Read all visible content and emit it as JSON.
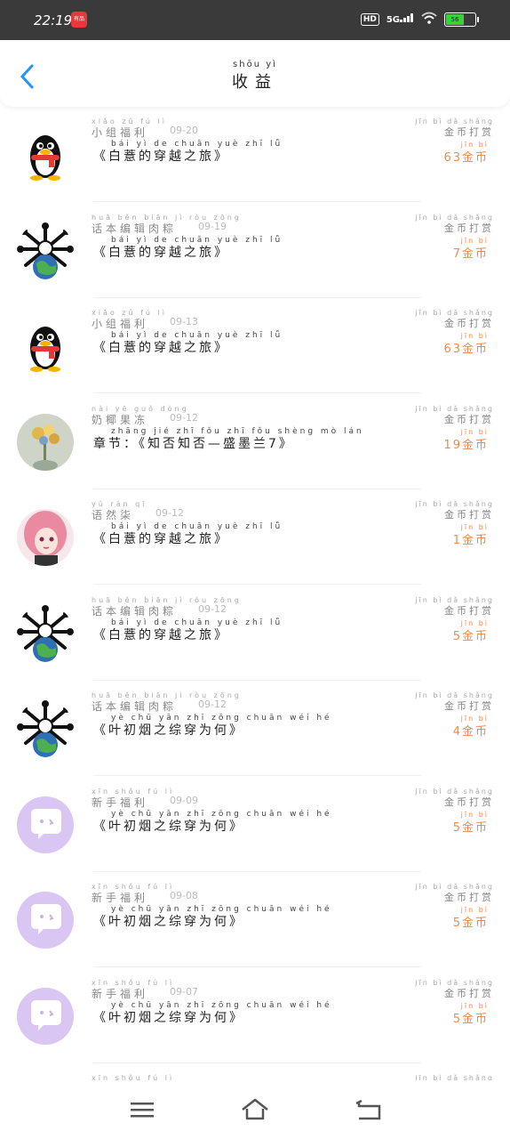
{
  "status": {
    "time": "22:19",
    "notif_text": "有品",
    "hd": "HD",
    "network": "5G",
    "battery": "56"
  },
  "header": {
    "title_pinyin": "shōu yì",
    "title": "收益"
  },
  "rows": [
    {
      "avatar": "penguin",
      "name_py": "xiǎo zǔ fú lì",
      "name": "小组福利",
      "date": "09-20",
      "book_py": "bái yì de chuān yuè zhī lǚ",
      "book": "《白薏的穿越之旅》",
      "label_py": "jīn bì dǎ shǎng",
      "label": "金币打赏",
      "amount_py": "jīn bì",
      "amount": "63金币"
    },
    {
      "avatar": "globe",
      "name_py": "huā běn biān jì ròu zōng",
      "name": "话本编辑肉粽",
      "date": "09-19",
      "book_py": "bái yì de chuān yuè zhī lǚ",
      "book": "《白薏的穿越之旅》",
      "label_py": "jīn bì dǎ shǎng",
      "label": "金币打赏",
      "amount_py": "jīn bì",
      "amount": "7金币"
    },
    {
      "avatar": "penguin",
      "name_py": "xiǎo zǔ fú lì",
      "name": "小组福利",
      "date": "09-13",
      "book_py": "bái yì de chuān yuè zhī lǚ",
      "book": "《白薏的穿越之旅》",
      "label_py": "jīn bì dǎ shǎng",
      "label": "金币打赏",
      "amount_py": "jīn bì",
      "amount": "63金币"
    },
    {
      "avatar": "flowers",
      "name_py": "nài yē guǒ dòng",
      "name": "奶椰果冻",
      "date": "09-12",
      "book_py": "zhāng jié zhī fǒu zhī fǒu shèng mò lán",
      "book": "章节：《知否知否—盛墨兰7》",
      "label_py": "jīn bì dǎ shǎng",
      "label": "金币打赏",
      "amount_py": "jīn bì",
      "amount": "19金币"
    },
    {
      "avatar": "anime",
      "name_py": "yǔ rán qī",
      "name": "语然柒",
      "date": "09-12",
      "book_py": "bái yì de chuān yuè zhī lǚ",
      "book": "《白薏的穿越之旅》",
      "label_py": "jīn bì dǎ shǎng",
      "label": "金币打赏",
      "amount_py": "jīn bì",
      "amount": "1金币"
    },
    {
      "avatar": "globe",
      "name_py": "huā běn biān jì ròu zōng",
      "name": "话本编辑肉粽",
      "date": "09-12",
      "book_py": "bái yì de chuān yuè zhī lǚ",
      "book": "《白薏的穿越之旅》",
      "label_py": "jīn bì dǎ shǎng",
      "label": "金币打赏",
      "amount_py": "jīn bì",
      "amount": "5金币"
    },
    {
      "avatar": "globe",
      "name_py": "huā běn biān jì ròu zōng",
      "name": "话本编辑肉粽",
      "date": "09-12",
      "book_py": "yè chū yān zhī zōng chuān wéi hé",
      "book": "《叶初烟之综穿为何》",
      "label_py": "jīn bì dǎ shǎng",
      "label": "金币打赏",
      "amount_py": "jīn bì",
      "amount": "4金币"
    },
    {
      "avatar": "bubble",
      "name_py": "xīn shǒu fú lì",
      "name": "新手福利",
      "date": "09-09",
      "book_py": "yè chū yān zhī zōng chuān wéi hé",
      "book": "《叶初烟之综穿为何》",
      "label_py": "jīn bì dǎ shǎng",
      "label": "金币打赏",
      "amount_py": "jīn bì",
      "amount": "5金币"
    },
    {
      "avatar": "bubble",
      "name_py": "xīn shǒu fú lì",
      "name": "新手福利",
      "date": "09-08",
      "book_py": "yè chū yān zhī zōng chuān wéi hé",
      "book": "《叶初烟之综穿为何》",
      "label_py": "jīn bì dǎ shǎng",
      "label": "金币打赏",
      "amount_py": "jīn bì",
      "amount": "5金币"
    },
    {
      "avatar": "bubble",
      "name_py": "xīn shǒu fú lì",
      "name": "新手福利",
      "date": "09-07",
      "book_py": "yè chū yān zhī zōng chuān wéi hé",
      "book": "《叶初烟之综穿为何》",
      "label_py": "jīn bì dǎ shǎng",
      "label": "金币打赏",
      "amount_py": "jīn bì",
      "amount": "5金币"
    },
    {
      "avatar": "bubble",
      "name_py": "xīn shǒu fú lì",
      "name": "",
      "date": "",
      "book_py": "",
      "book": "",
      "label_py": "jīn bì dǎ shǎng",
      "label": "",
      "amount_py": "",
      "amount": ""
    }
  ],
  "nav": {
    "menu": "menu-icon",
    "home": "home-icon",
    "back": "back-nav-icon"
  }
}
